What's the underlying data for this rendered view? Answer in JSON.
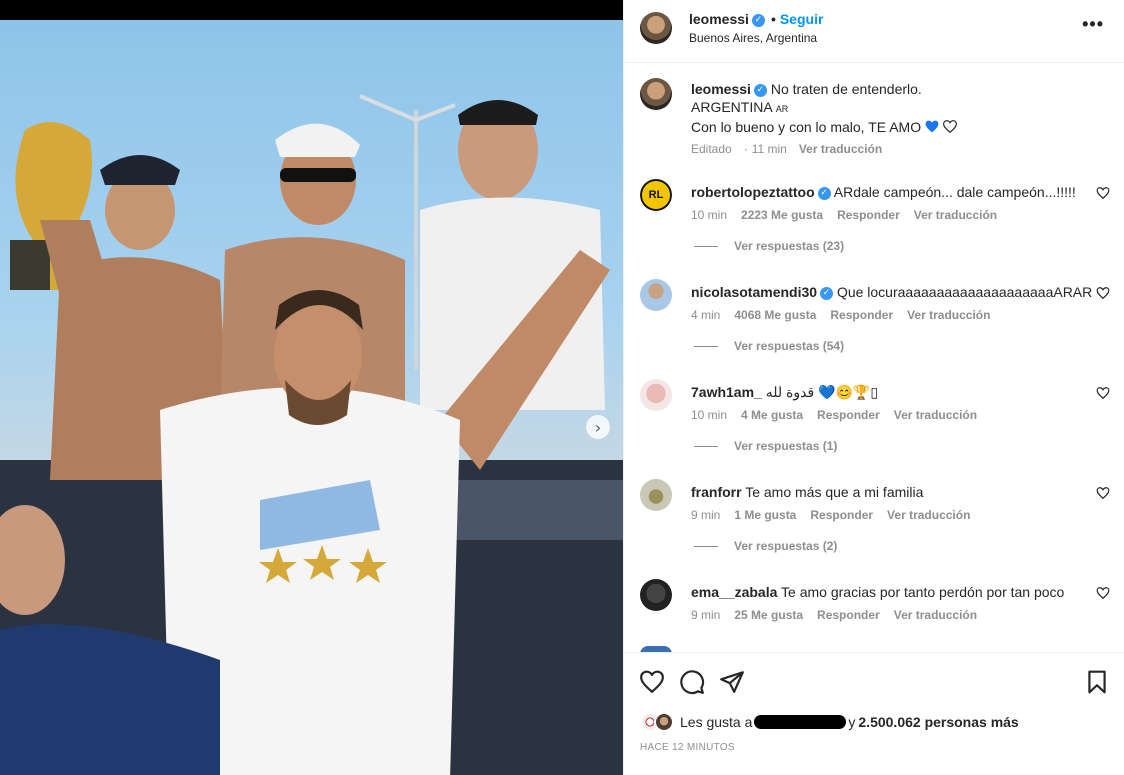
{
  "header": {
    "username": "leomessi",
    "separator": "•",
    "follow_label": "Seguir",
    "location": "Buenos Aires, Argentina",
    "more_label": "•••"
  },
  "caption": {
    "username": "leomessi",
    "line1": "No traten de entenderlo.",
    "line2": "ARGENTINA",
    "line2_flag": "AR",
    "line3": "Con lo bueno y con lo malo, TE AMO",
    "edited": "Editado",
    "dot": "·",
    "time": "11 min",
    "see_translation": "Ver traducción"
  },
  "comments": [
    {
      "username": "robertolopeztattoo",
      "verified": true,
      "text": "ARdale campeón... dale campeón...!!!!!",
      "time": "10 min",
      "likes": "2223 Me gusta",
      "reply": "Responder",
      "translate": "Ver traducción",
      "replies": "Ver respuestas (23)",
      "avatar_text": "RL"
    },
    {
      "username": "nicolasotamendi30",
      "verified": true,
      "text": "Que locuraaaaaaaaaaaaaaaaaaaaARAR",
      "time": "4 min",
      "likes": "4068 Me gusta",
      "reply": "Responder",
      "translate": "Ver traducción",
      "replies": "Ver respuestas (54)"
    },
    {
      "username": "7awh1am_",
      "verified": false,
      "text": "قدوة لله 💙😊🏆▯",
      "time": "10 min",
      "likes": "4 Me gusta",
      "reply": "Responder",
      "translate": "Ver traducción",
      "replies": "Ver respuestas (1)"
    },
    {
      "username": "franforr",
      "verified": false,
      "text": "Te amo más que a mi familia",
      "time": "9 min",
      "likes": "1 Me gusta",
      "reply": "Responder",
      "translate": "Ver traducción",
      "replies": "Ver respuestas (2)"
    },
    {
      "username": "ema__zabala",
      "verified": false,
      "text": "Te amo gracias por tanto perdón por tan poco",
      "time": "9 min",
      "likes": "25 Me gusta",
      "reply": "Responder",
      "translate": "Ver traducción"
    }
  ],
  "likes": {
    "prefix": "Les gusta a",
    "suffix": "y",
    "count": "2.500.062 personas más"
  },
  "time_ago": "HACE 12 MINUTOS",
  "colors": {
    "accent": "#0095f6",
    "verified": "#3897f0",
    "muted": "#8e8e8e",
    "heart_blue": "#1877f2"
  }
}
